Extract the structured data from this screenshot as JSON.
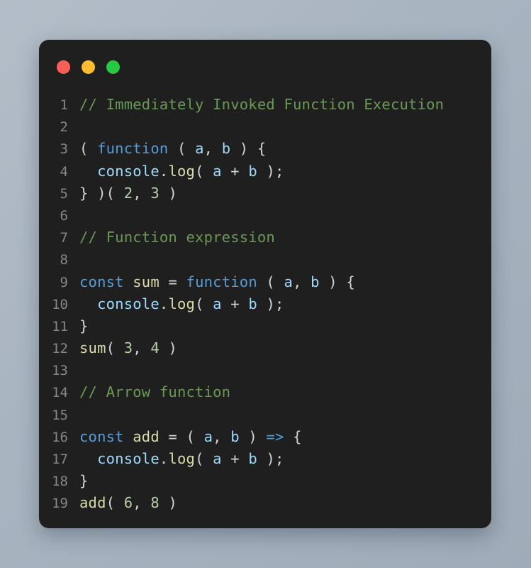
{
  "window": {
    "title": "",
    "traffic_lights": [
      {
        "name": "close",
        "color": "#ff5f57"
      },
      {
        "name": "minimize",
        "color": "#febc2e"
      },
      {
        "name": "maximize",
        "color": "#28c840"
      }
    ]
  },
  "theme": {
    "page_background": "#a8b3c0",
    "card_background": "#1f1f1f",
    "line_number_color": "#868686",
    "default_text": "#d4d4d4",
    "comment": "#6a9955",
    "keyword": "#569cd6",
    "function_name": "#dcdcaa",
    "variable": "#9cdcfe",
    "number": "#b5cea8"
  },
  "editor": {
    "language": "javascript",
    "first_line_number": 1,
    "last_line_number": 19,
    "lines": [
      {
        "n": "1",
        "text": "// Immediately Invoked Function Execution",
        "tokens": [
          {
            "t": "// Immediately Invoked Function Execution",
            "c": "t-comment"
          }
        ]
      },
      {
        "n": "2",
        "text": "",
        "tokens": []
      },
      {
        "n": "3",
        "text": "( function ( a, b ) {",
        "tokens": [
          {
            "t": "( ",
            "c": "t-plain"
          },
          {
            "t": "function",
            "c": "t-keyword"
          },
          {
            "t": " ( ",
            "c": "t-plain"
          },
          {
            "t": "a",
            "c": "t-var"
          },
          {
            "t": ", ",
            "c": "t-plain"
          },
          {
            "t": "b",
            "c": "t-var"
          },
          {
            "t": " ) {",
            "c": "t-plain"
          }
        ]
      },
      {
        "n": "4",
        "text": "  console.log( a + b );",
        "tokens": [
          {
            "t": "  ",
            "c": "t-plain"
          },
          {
            "t": "console",
            "c": "t-var"
          },
          {
            "t": ".",
            "c": "t-plain"
          },
          {
            "t": "log",
            "c": "t-prop"
          },
          {
            "t": "( ",
            "c": "t-plain"
          },
          {
            "t": "a",
            "c": "t-var"
          },
          {
            "t": " + ",
            "c": "t-plain"
          },
          {
            "t": "b",
            "c": "t-var"
          },
          {
            "t": " );",
            "c": "t-plain"
          }
        ]
      },
      {
        "n": "5",
        "text": "} )( 2, 3 )",
        "tokens": [
          {
            "t": "} )( ",
            "c": "t-plain"
          },
          {
            "t": "2",
            "c": "t-num"
          },
          {
            "t": ", ",
            "c": "t-plain"
          },
          {
            "t": "3",
            "c": "t-num"
          },
          {
            "t": " )",
            "c": "t-plain"
          }
        ]
      },
      {
        "n": "6",
        "text": "",
        "tokens": []
      },
      {
        "n": "7",
        "text": "// Function expression",
        "tokens": [
          {
            "t": "// Function expression",
            "c": "t-comment"
          }
        ]
      },
      {
        "n": "8",
        "text": "",
        "tokens": []
      },
      {
        "n": "9",
        "text": "const sum = function ( a, b ) {",
        "tokens": [
          {
            "t": "const",
            "c": "t-keyword"
          },
          {
            "t": " ",
            "c": "t-plain"
          },
          {
            "t": "sum",
            "c": "t-func"
          },
          {
            "t": " = ",
            "c": "t-plain"
          },
          {
            "t": "function",
            "c": "t-keyword"
          },
          {
            "t": " ( ",
            "c": "t-plain"
          },
          {
            "t": "a",
            "c": "t-var"
          },
          {
            "t": ", ",
            "c": "t-plain"
          },
          {
            "t": "b",
            "c": "t-var"
          },
          {
            "t": " ) {",
            "c": "t-plain"
          }
        ]
      },
      {
        "n": "10",
        "text": "  console.log( a + b );",
        "tokens": [
          {
            "t": "  ",
            "c": "t-plain"
          },
          {
            "t": "console",
            "c": "t-var"
          },
          {
            "t": ".",
            "c": "t-plain"
          },
          {
            "t": "log",
            "c": "t-prop"
          },
          {
            "t": "( ",
            "c": "t-plain"
          },
          {
            "t": "a",
            "c": "t-var"
          },
          {
            "t": " + ",
            "c": "t-plain"
          },
          {
            "t": "b",
            "c": "t-var"
          },
          {
            "t": " );",
            "c": "t-plain"
          }
        ]
      },
      {
        "n": "11",
        "text": "}",
        "tokens": [
          {
            "t": "}",
            "c": "t-plain"
          }
        ]
      },
      {
        "n": "12",
        "text": "sum( 3, 4 )",
        "tokens": [
          {
            "t": "sum",
            "c": "t-func"
          },
          {
            "t": "( ",
            "c": "t-plain"
          },
          {
            "t": "3",
            "c": "t-num"
          },
          {
            "t": ", ",
            "c": "t-plain"
          },
          {
            "t": "4",
            "c": "t-num"
          },
          {
            "t": " )",
            "c": "t-plain"
          }
        ]
      },
      {
        "n": "13",
        "text": "",
        "tokens": []
      },
      {
        "n": "14",
        "text": "// Arrow function",
        "tokens": [
          {
            "t": "// Arrow function",
            "c": "t-comment"
          }
        ]
      },
      {
        "n": "15",
        "text": "",
        "tokens": []
      },
      {
        "n": "16",
        "text": "const add = ( a, b ) => {",
        "tokens": [
          {
            "t": "const",
            "c": "t-keyword"
          },
          {
            "t": " ",
            "c": "t-plain"
          },
          {
            "t": "add",
            "c": "t-func"
          },
          {
            "t": " = ( ",
            "c": "t-plain"
          },
          {
            "t": "a",
            "c": "t-var"
          },
          {
            "t": ", ",
            "c": "t-plain"
          },
          {
            "t": "b",
            "c": "t-var"
          },
          {
            "t": " ) ",
            "c": "t-plain"
          },
          {
            "t": "=>",
            "c": "t-keyword"
          },
          {
            "t": " {",
            "c": "t-plain"
          }
        ]
      },
      {
        "n": "17",
        "text": "  console.log( a + b );",
        "tokens": [
          {
            "t": "  ",
            "c": "t-plain"
          },
          {
            "t": "console",
            "c": "t-var"
          },
          {
            "t": ".",
            "c": "t-plain"
          },
          {
            "t": "log",
            "c": "t-prop"
          },
          {
            "t": "( ",
            "c": "t-plain"
          },
          {
            "t": "a",
            "c": "t-var"
          },
          {
            "t": " + ",
            "c": "t-plain"
          },
          {
            "t": "b",
            "c": "t-var"
          },
          {
            "t": " );",
            "c": "t-plain"
          }
        ]
      },
      {
        "n": "18",
        "text": "}",
        "tokens": [
          {
            "t": "}",
            "c": "t-plain"
          }
        ]
      },
      {
        "n": "19",
        "text": "add( 6, 8 )",
        "tokens": [
          {
            "t": "add",
            "c": "t-func"
          },
          {
            "t": "( ",
            "c": "t-plain"
          },
          {
            "t": "6",
            "c": "t-num"
          },
          {
            "t": ", ",
            "c": "t-plain"
          },
          {
            "t": "8",
            "c": "t-num"
          },
          {
            "t": " )",
            "c": "t-plain"
          }
        ]
      }
    ]
  }
}
